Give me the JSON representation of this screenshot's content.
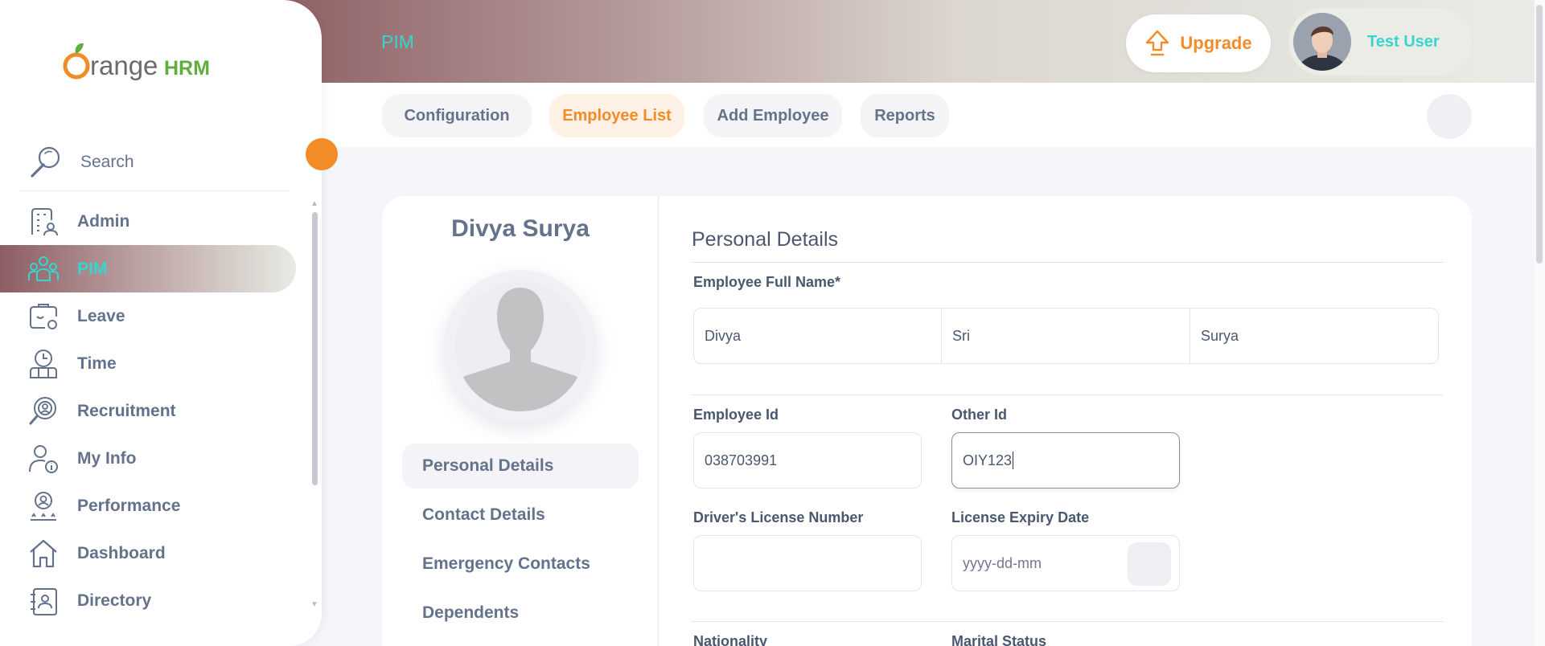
{
  "header": {
    "module_title": "PIM",
    "upgrade_label": "Upgrade",
    "user_name": "Test User"
  },
  "sidebar": {
    "search_label": "Search",
    "items": [
      {
        "label": "Admin",
        "icon": "admin-icon"
      },
      {
        "label": "PIM",
        "icon": "pim-icon",
        "active": true
      },
      {
        "label": "Leave",
        "icon": "leave-icon"
      },
      {
        "label": "Time",
        "icon": "time-icon"
      },
      {
        "label": "Recruitment",
        "icon": "recruitment-icon"
      },
      {
        "label": "My Info",
        "icon": "my-info-icon"
      },
      {
        "label": "Performance",
        "icon": "performance-icon"
      },
      {
        "label": "Dashboard",
        "icon": "dashboard-icon"
      },
      {
        "label": "Directory",
        "icon": "directory-icon"
      }
    ]
  },
  "subnav": {
    "tabs": [
      {
        "label": "Configuration"
      },
      {
        "label": "Employee List",
        "active": true
      },
      {
        "label": "Add Employee"
      },
      {
        "label": "Reports"
      }
    ]
  },
  "employee": {
    "display_name": "Divya Surya"
  },
  "profile_tabs": [
    {
      "label": "Personal Details",
      "active": true
    },
    {
      "label": "Contact Details"
    },
    {
      "label": "Emergency Contacts"
    },
    {
      "label": "Dependents"
    }
  ],
  "form": {
    "section_title": "Personal Details",
    "full_name_label": "Employee Full Name*",
    "first_name": "Divya",
    "middle_name": "Sri",
    "last_name": "Surya",
    "employee_id_label": "Employee Id",
    "employee_id": "038703991",
    "other_id_label": "Other Id",
    "other_id": "OIY123",
    "license_label": "Driver's License Number",
    "license_value": "",
    "expiry_label": "License Expiry Date",
    "expiry_placeholder": "yyyy-dd-mm",
    "nationality_label": "Nationality",
    "marital_label": "Marital Status"
  },
  "colors": {
    "accent": "#f28c28",
    "teal": "#36d6cf",
    "text": "#64728c"
  }
}
